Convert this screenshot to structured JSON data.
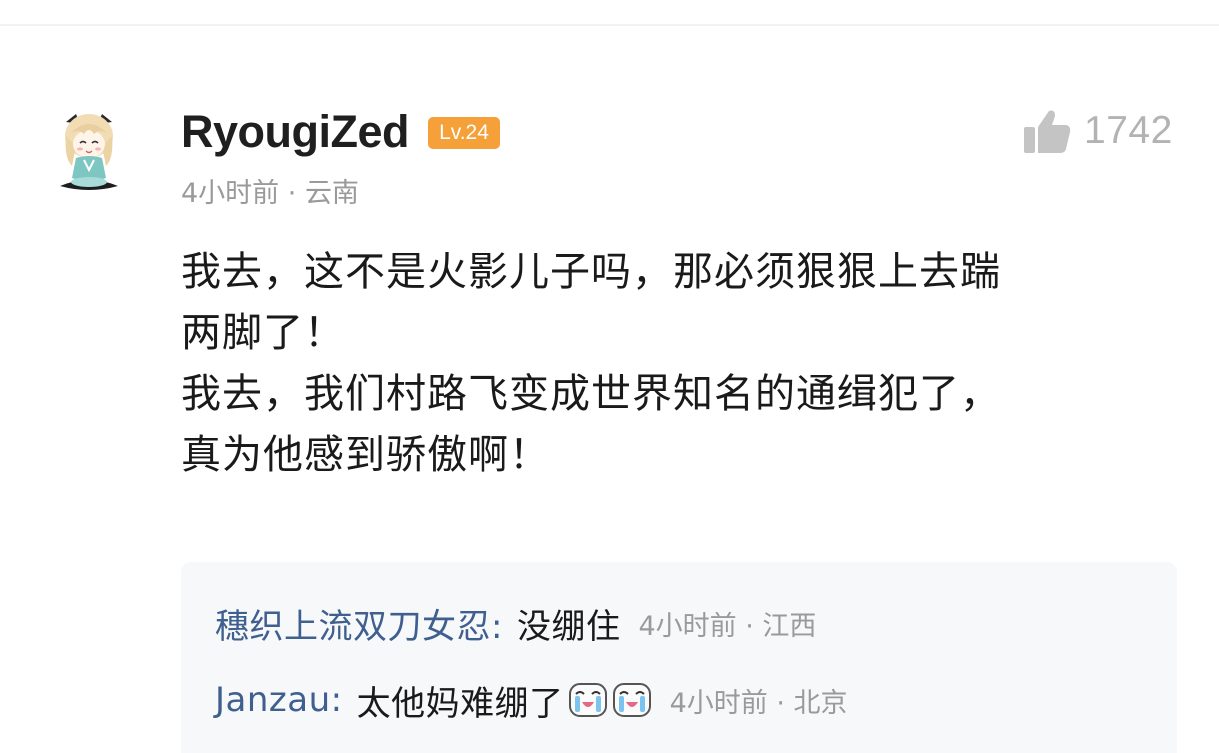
{
  "comment": {
    "username": "RyougiZed",
    "level": "Lv.24",
    "time": "4小时前",
    "location": "云南",
    "meta_separator": " · ",
    "likes": "1742",
    "lines": [
      "我去，这不是火影儿子吗，那必须狠狠上去踹",
      "两脚了！",
      "我去，我们村路飞变成世界知名的通缉犯了，",
      "真为他感到骄傲啊！"
    ]
  },
  "replies": [
    {
      "author": "穗织上流双刀女忍:",
      "text": "没绷住",
      "time": "4小时前",
      "location": "江西"
    },
    {
      "author": "Janzau:",
      "text": "太他妈难绷了",
      "emojis": [
        "crying-laugh-emoji",
        "crying-laugh-emoji"
      ],
      "time": "4小时前",
      "location": "北京"
    }
  ],
  "colors": {
    "level_badge": "#f5a038",
    "reply_author": "#3f5f8f",
    "meta": "#9a9a9a",
    "like": "#b3b3b3",
    "reply_bg": "#f7f8fa"
  }
}
